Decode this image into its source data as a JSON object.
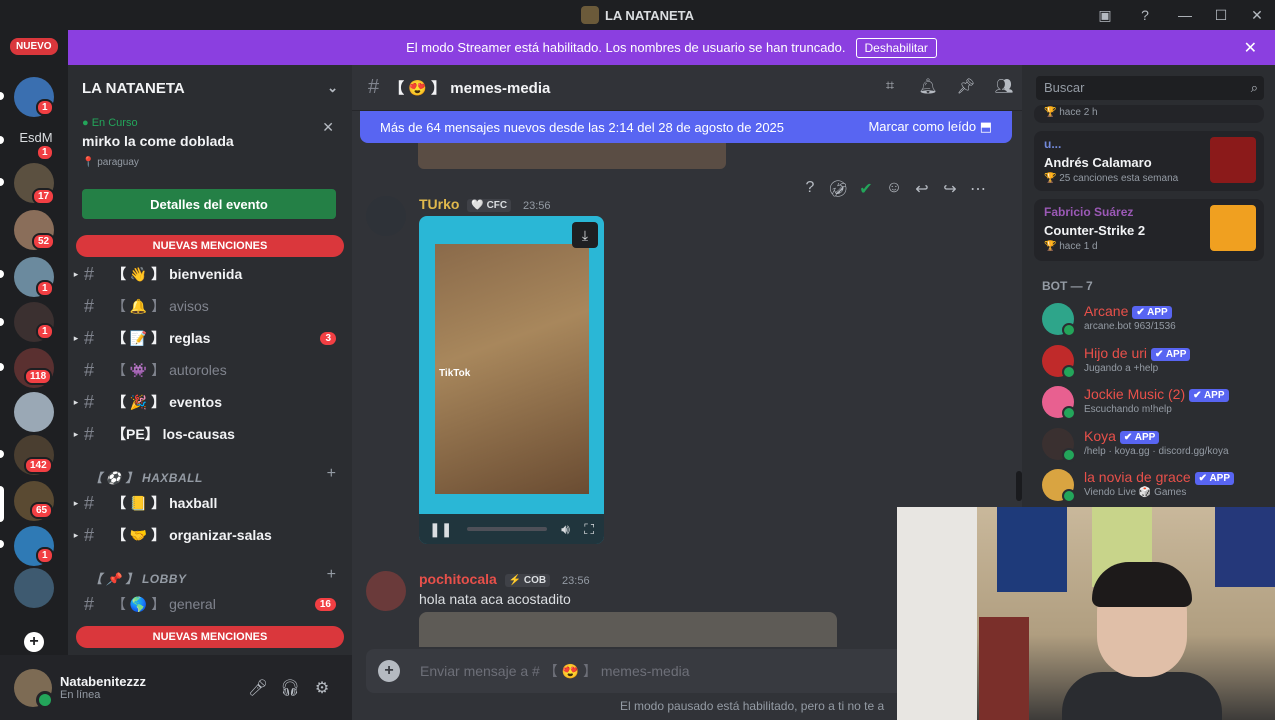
{
  "titlebar": {
    "title": "LA NATANETA"
  },
  "banner": {
    "text": "El modo Streamer está habilitado. Los nombres de usuario se han truncado.",
    "button": "Deshabilitar"
  },
  "rail": {
    "nuevo": "NUEVO",
    "text_server": "EsdM",
    "badges": [
      "1",
      "1",
      "17",
      "52",
      "1",
      "1",
      "118",
      "142",
      "65",
      "1"
    ]
  },
  "sidebar": {
    "server_name": "LA NATANETA",
    "event": {
      "live_label": "En Curso",
      "title": "mirko la come doblada",
      "location": "paraguay",
      "button": "Detalles del evento"
    },
    "mentions_label": "NUEVAS MENCIONES",
    "channels": [
      {
        "emoji": "【 👋 】",
        "name": "bienvenida",
        "unread": true
      },
      {
        "emoji": "【 🔔 】",
        "name": "avisos",
        "unread": false
      },
      {
        "emoji": "【 📝 】",
        "name": "reglas",
        "unread": true,
        "badge": "3"
      },
      {
        "emoji": "【 👾 】",
        "name": "autoroles",
        "unread": false
      },
      {
        "emoji": "【 🎉 】",
        "name": "eventos",
        "unread": true
      },
      {
        "emoji": "【PE】",
        "name": "los-causas",
        "unread": true
      }
    ],
    "category_haxball": "【 ⚽ 】 HAXBALL",
    "haxball_channels": [
      {
        "emoji": "【 📒 】",
        "name": "haxball"
      },
      {
        "emoji": "【 🤝 】",
        "name": "organizar-salas"
      }
    ],
    "category_lobby": "【 📌 】 LOBBY",
    "lobby_channel": {
      "emoji": "【 🌎 】",
      "name": "general",
      "badge": "16"
    }
  },
  "user": {
    "name": "Natabenitezzz",
    "status": "En línea"
  },
  "chat": {
    "channel_name": "【 😍 】 memes-media",
    "new_messages": "Más de 64 mensajes nuevos desde las 2:14 del 28 de agosto de 2025",
    "mark_read": "Marcar como leído",
    "msg1": {
      "author": "TUrko",
      "tag": "🤍 CFC",
      "time": "23:56",
      "tiktok": "TikTok"
    },
    "msg2": {
      "author": "pochitocala",
      "tag": "⚡ COB",
      "time": "23:56",
      "text": "hola nata aca acostadito"
    },
    "composer_placeholder": "Enviar mensaje a # 【 😍 】 memes-media",
    "paused": "El modo pausado está habilitado, pero a ti no te a"
  },
  "members": {
    "search_placeholder": "Buscar",
    "top_card_time": "hace 2 h",
    "activity1": {
      "user": "u...",
      "title": "Andrés Calamaro",
      "sub": "25 canciones esta semana"
    },
    "activity2": {
      "user": "Fabricio Suárez",
      "title": "Counter-Strike 2",
      "sub": "hace 1 d"
    },
    "section": "BOT — 7",
    "app_tag": "APP",
    "bots": [
      {
        "name": "Arcane",
        "status": "arcane.bot 963/1536",
        "color": "#e8504a"
      },
      {
        "name": "Hijo de uri",
        "status": "Jugando a +help",
        "color": "#e8504a"
      },
      {
        "name": "Jockie Music (2)",
        "status": "Escuchando m!help",
        "color": "#e8504a"
      },
      {
        "name": "Koya",
        "status": "/help · koya.gg · discord.gg/koya",
        "color": "#e8504a"
      },
      {
        "name": "la novia de grace",
        "status": "Viendo Live 🎲 Games",
        "color": "#e8504a"
      }
    ]
  },
  "colors": {
    "accent": "#5865f2",
    "streamer": "#8b3fe0",
    "mention": "#da373c",
    "online": "#23a55a"
  }
}
